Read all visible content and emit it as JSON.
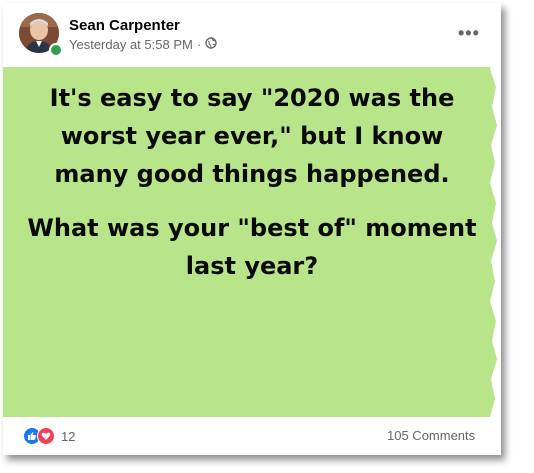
{
  "post": {
    "author": "Sean Carpenter",
    "timestamp": "Yesterday at 5:58 PM",
    "separator": "·",
    "audience_icon": "globe-icon",
    "more_label": "•••",
    "background_color": "#b8e48a",
    "text_lines_1": "It's easy to say \"2020 was the worst year ever,\" but I know many good things happened.",
    "text_lines_2": "What was your \"best of\" moment last year?"
  },
  "footer": {
    "reaction_icons": [
      "like-icon",
      "love-icon"
    ],
    "reaction_count": "12",
    "comments_label": "105 Comments"
  },
  "colors": {
    "like": "#1877f2",
    "love": "#f33e58",
    "online": "#31a24c"
  }
}
